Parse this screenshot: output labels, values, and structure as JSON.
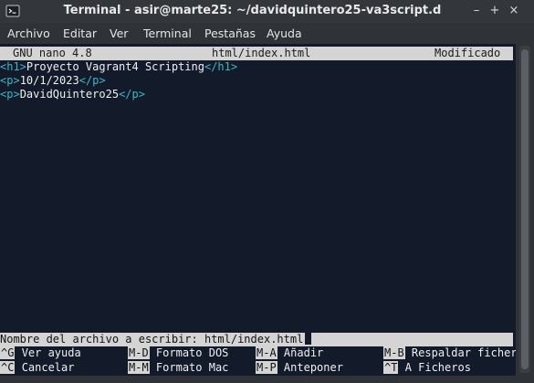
{
  "window": {
    "title": "Terminal - asir@marte25: ~/davidquintero25-va3script.d",
    "controls": {
      "minimize": "–",
      "maximize": "+",
      "close": "×"
    }
  },
  "menu": [
    "Archivo",
    "Editar",
    "Ver",
    "Terminal",
    "Pestañas",
    "Ayuda"
  ],
  "nano": {
    "version": "GNU nano 4.8",
    "filename": "html/index.html",
    "status": "Modificado",
    "lines": [
      {
        "open": "<h1>",
        "text": "Proyecto Vagrant4 Scripting",
        "close": "</h1>"
      },
      {
        "open": "<p>",
        "text": "10/1/2023",
        "close": "</p>"
      },
      {
        "open": "<p>",
        "text": "DavidQuintero25",
        "close": "</p>"
      }
    ],
    "prompt": "Nombre del archivo a escribir: html/index.html",
    "shortcuts": [
      {
        "key": "^G",
        "label": "Ver ayuda"
      },
      {
        "key": "M-D",
        "label": "Formato DOS"
      },
      {
        "key": "M-A",
        "label": "Añadir"
      },
      {
        "key": "M-B",
        "label": "Respaldar ficher"
      },
      {
        "key": "^C",
        "label": "Cancelar"
      },
      {
        "key": "M-M",
        "label": "Formato Mac"
      },
      {
        "key": "M-P",
        "label": "Anteponer"
      },
      {
        "key": "^T",
        "label": "A Ficheros"
      }
    ]
  },
  "colors": {
    "terminal_bg": "#131a2a",
    "tag": "#3eb6c8",
    "bar_bg": "#d4d4d4"
  }
}
